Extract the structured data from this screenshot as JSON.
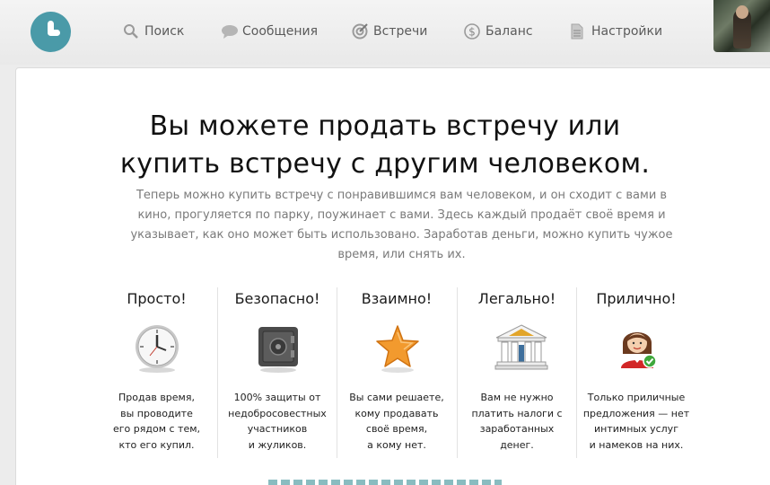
{
  "header": {
    "nav": [
      {
        "label": "Поиск",
        "icon": "search-icon"
      },
      {
        "label": "Сообщения",
        "icon": "chat-bubble-icon"
      },
      {
        "label": "Встречи",
        "icon": "target-icon"
      },
      {
        "label": "Баланс",
        "icon": "dollar-coin-icon"
      },
      {
        "label": "Настройки",
        "icon": "document-icon"
      }
    ]
  },
  "hero": {
    "title_line1": "Вы можете продать встречу или",
    "title_line2": "купить встречу с другим человеком.",
    "subtitle": "Теперь можно купить встречу с понравившимся вам человеком, и он сходит с вами в кино, прогуляется по парку, поужинает с вами. Здесь каждый продаёт своё время и указывает, как оно может быть использовано. Заработав деньги, можно купить чужое время, или снять их."
  },
  "features": [
    {
      "title": "Просто!",
      "icon": "clock-icon",
      "lines": [
        "Продав время,",
        "вы проводите",
        "его рядом с тем,",
        "кто его купил."
      ]
    },
    {
      "title": "Безопасно!",
      "icon": "safe-icon",
      "lines": [
        "100% защиты от",
        "недобросовестных",
        "участников",
        "и жуликов."
      ]
    },
    {
      "title": "Взаимно!",
      "icon": "star-icon",
      "lines": [
        "Вы сами решаете,",
        "кому продавать",
        "своё время,",
        "а кому нет."
      ]
    },
    {
      "title": "Легально!",
      "icon": "bank-building-icon",
      "lines": [
        "Вам не нужно",
        "платить налоги с",
        "заработанных",
        "денег."
      ]
    },
    {
      "title": "Прилично!",
      "icon": "woman-check-icon",
      "lines": [
        "Только приличные",
        "предложения — нет",
        "интимных услуг",
        "и намеков на них."
      ]
    }
  ],
  "colors": {
    "accent": "#4a9aa8",
    "text": "#111111",
    "muted": "#7a7a7a"
  }
}
